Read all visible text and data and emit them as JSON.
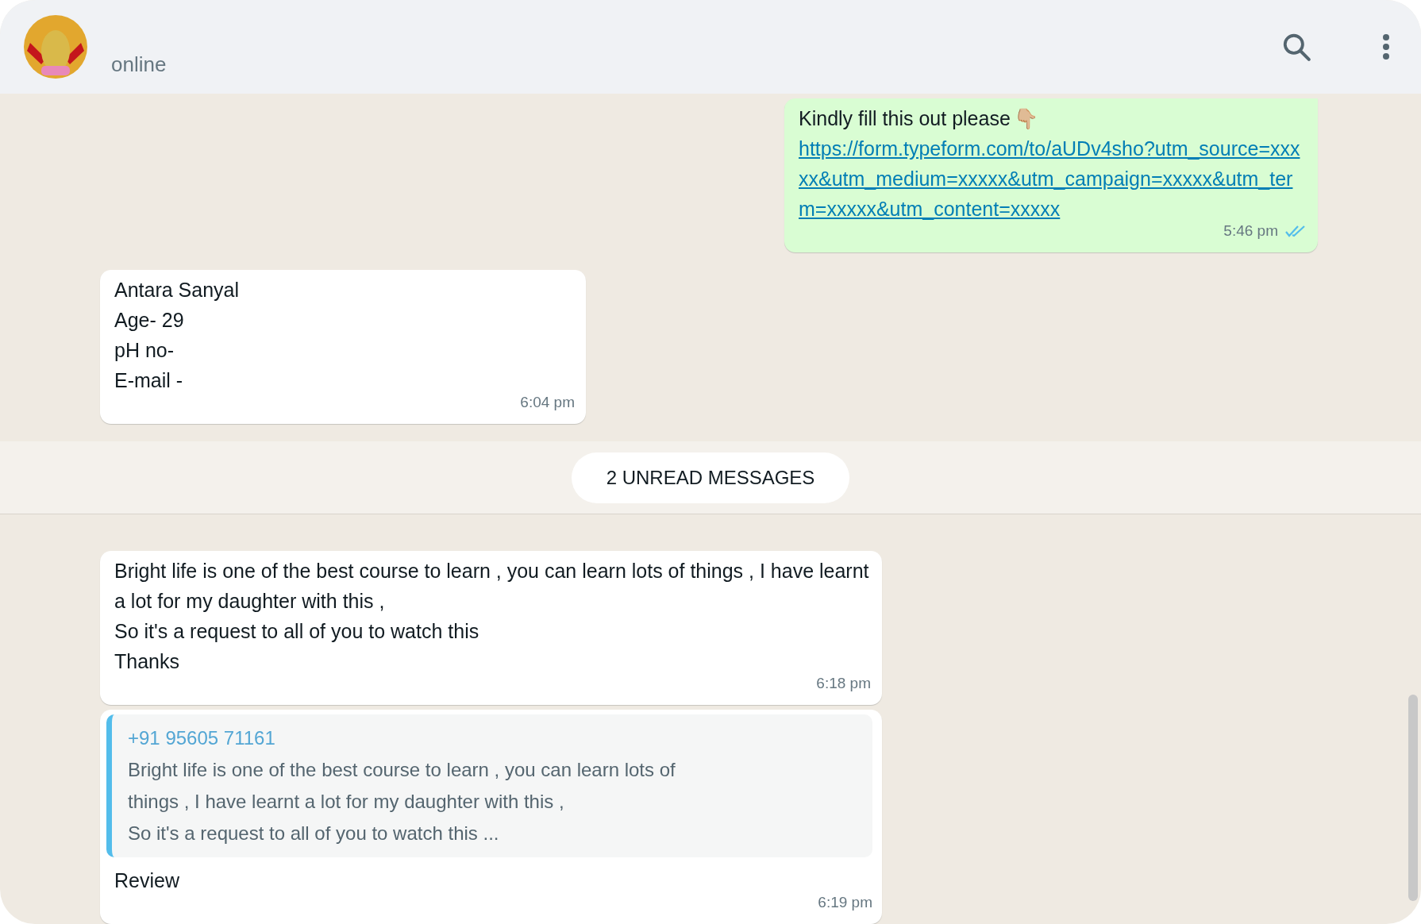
{
  "header": {
    "status": "online"
  },
  "messages": [
    {
      "kind": "outgoing",
      "lines": [
        "Kindly fill this out please"
      ],
      "emoji": "👇🏼",
      "link": "https://form.typeform.com/to/aUDv4sho?utm_source=xxxxx&utm_medium=xxxxx&utm_campaign=xxxxx&utm_term=xxxxx&utm_content=xxxxx",
      "time": "5:46 pm",
      "read": true
    },
    {
      "kind": "incoming",
      "text": "Antara Sanyal\nAge- 29\npH no-\nE-mail -",
      "time": "6:04 pm"
    },
    {
      "kind": "divider",
      "label": "2 UNREAD MESSAGES"
    },
    {
      "kind": "incoming",
      "text": "Bright life is one of the best course to learn , you can learn lots of things , I have learnt a lot for my daughter with this ,\nSo it's a request to all of you to watch this\nThanks",
      "time": "6:18 pm"
    },
    {
      "kind": "reply",
      "quote": {
        "author": "+91 95605 71161",
        "text": "Bright life is one of the best course to learn , you can learn lots of things , I have learnt a lot for my daughter with this ,\nSo it's a request to all of you to watch this ..."
      },
      "text": "Review",
      "time": "6:19 pm"
    }
  ]
}
